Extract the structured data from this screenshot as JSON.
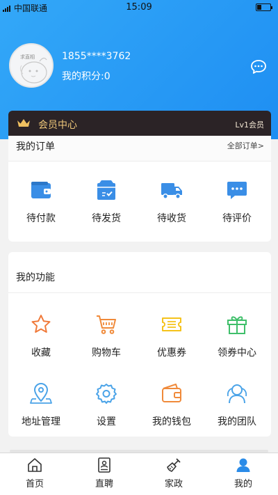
{
  "status_bar": {
    "carrier": "中国联通",
    "time": "15:09"
  },
  "profile": {
    "avatar_text": "求直相",
    "phone": "1855****3762",
    "points": "我的积分:0"
  },
  "member": {
    "label": "会员中心",
    "level": "Lv1会员"
  },
  "orders": {
    "title": "我的订单",
    "all_label": "全部订单>",
    "items": [
      {
        "label": "待付款",
        "icon": "wallet-icon"
      },
      {
        "label": "待发货",
        "icon": "package-icon"
      },
      {
        "label": "待收货",
        "icon": "truck-icon"
      },
      {
        "label": "待评价",
        "icon": "comment-icon"
      }
    ]
  },
  "functions": {
    "title": "我的功能",
    "items": [
      {
        "label": "收藏",
        "icon": "star-icon"
      },
      {
        "label": "购物车",
        "icon": "cart-icon"
      },
      {
        "label": "优惠券",
        "icon": "coupon-icon"
      },
      {
        "label": "领券中心",
        "icon": "gift-icon"
      },
      {
        "label": "地址管理",
        "icon": "location-icon"
      },
      {
        "label": "设置",
        "icon": "settings-icon"
      },
      {
        "label": "我的钱包",
        "icon": "wallet-icon"
      },
      {
        "label": "我的团队",
        "icon": "team-icon"
      }
    ]
  },
  "tabbar": {
    "items": [
      {
        "label": "首页",
        "icon": "home-icon"
      },
      {
        "label": "直聘",
        "icon": "resume-icon"
      },
      {
        "label": "家政",
        "icon": "broom-icon"
      },
      {
        "label": "我的",
        "icon": "user-icon"
      }
    ]
  },
  "colors": {
    "header_blue": "#2196f3",
    "member_bg": "#2b2326",
    "member_gold": "#f0c87a",
    "order_blue": "#3a8ee6",
    "star_orange": "#f07a3a",
    "cart_orange": "#f08a3a",
    "coupon_yellow": "#f5c21b",
    "gift_green": "#3fbf6a",
    "location_blue": "#4aa3e8",
    "settings_blue": "#4aa3e8",
    "wallet_orange": "#f08a3a",
    "team_blue": "#4aa3e8"
  }
}
